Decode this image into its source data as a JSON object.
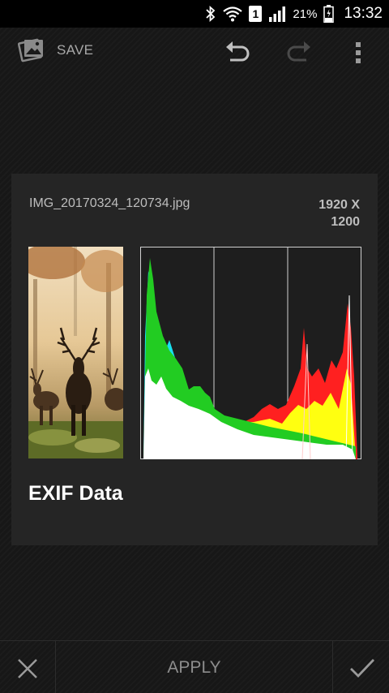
{
  "status_bar": {
    "icons": [
      "bluetooth-icon",
      "wifi-icon",
      "sim-icon",
      "signal-icon",
      "battery-icon"
    ],
    "sim_slot": "1",
    "battery": "21%",
    "time": "13:32"
  },
  "action_bar": {
    "save_label": "SAVE",
    "icons": [
      "photo-app-icon",
      "undo-icon",
      "redo-icon",
      "overflow-menu-icon"
    ]
  },
  "dialog": {
    "filename": "IMG_20170324_120734.jpg",
    "dims_line1": "1920 X",
    "dims_line2": "1200",
    "title": "EXIF Data",
    "histogram_colors": {
      "white": "#ffffff",
      "red": "#ff2020",
      "yellow": "#ffff00",
      "green": "#22cc22",
      "cyan": "#18e0f0",
      "blue": "#2a3cf0",
      "magenta": "#e040e0"
    }
  },
  "bottom_bar": {
    "apply_label": "APPLY",
    "icons": [
      "close-icon",
      "check-icon"
    ]
  }
}
